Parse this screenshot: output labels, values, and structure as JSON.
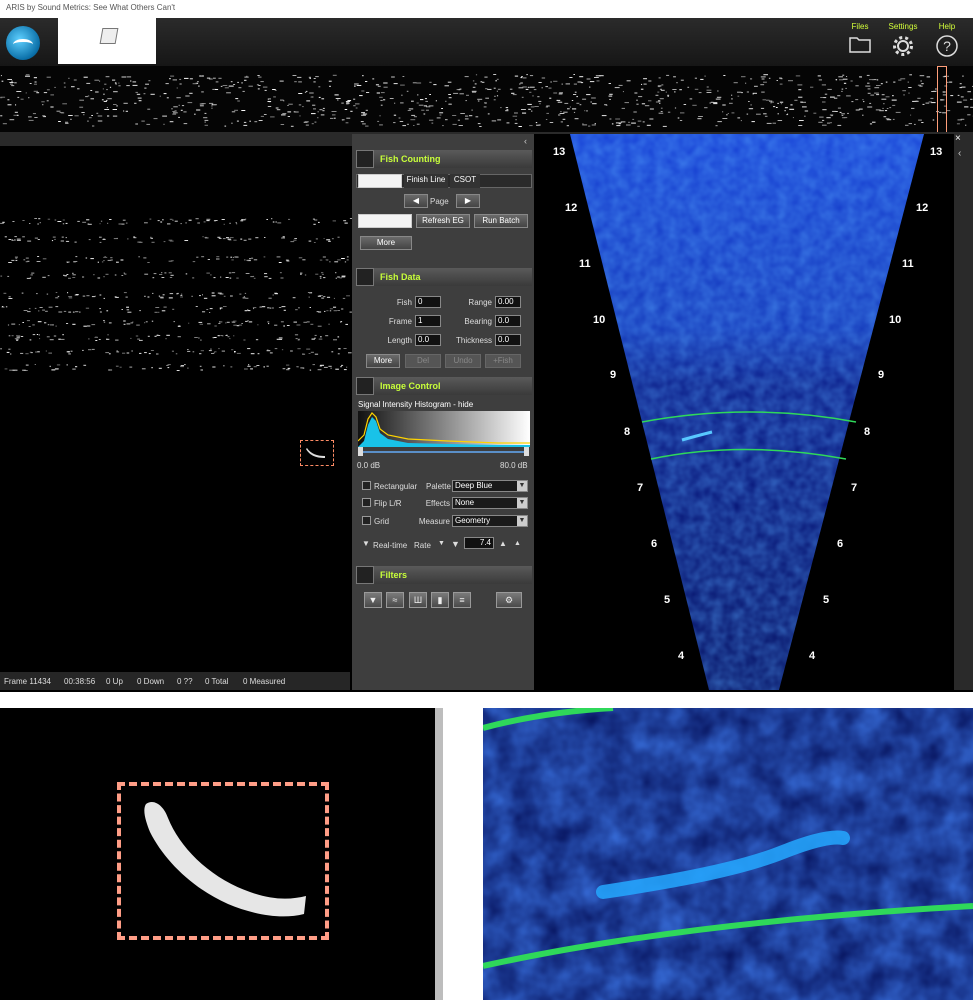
{
  "window": {
    "title": "ARIS by Sound Metrics: See What Others Can't"
  },
  "toolbar": {
    "files_label": "Files",
    "settings_label": "Settings",
    "help_label": "Help",
    "files_icon": "folder-icon",
    "settings_icon": "gear-icon",
    "help_icon": "help-icon"
  },
  "status": {
    "frame": "Frame 11434",
    "time": "00:38:56",
    "up": "0 Up",
    "down": "0 Down",
    "unknown": "0 ??",
    "total": "0 Total",
    "measured": "0 Measured"
  },
  "fish_counting": {
    "title": "Fish Counting",
    "tabs": [
      "Finish Line",
      "CSOT"
    ],
    "page_label": "Page",
    "refresh_eg": "Refresh EG",
    "run_batch": "Run Batch",
    "more": "More"
  },
  "fish_data": {
    "title": "Fish Data",
    "fish_label": "Fish",
    "fish_value": "0",
    "range_label": "Range",
    "range_value": "0.00",
    "frame_label": "Frame",
    "frame_value": "1",
    "bearing_label": "Bearing",
    "bearing_value": "0.0",
    "length_label": "Length",
    "length_value": "0.0",
    "thickness_label": "Thickness",
    "thickness_value": "0.0",
    "more": "More",
    "del": "Del",
    "undo": "Undo",
    "add_fish": "+Fish"
  },
  "image_control": {
    "title": "Image Control",
    "histogram_label": "Signal Intensity Histogram - hide",
    "min_db": "0.0 dB",
    "max_db": "80.0 dB",
    "rectangular": "Rectangular",
    "flip": "Flip L/R",
    "grid": "Grid",
    "palette_label": "Palette",
    "palette_value": "Deep Blue",
    "effects_label": "Effects",
    "effects_value": "None",
    "measure_label": "Measure",
    "measure_value": "Geometry",
    "realtime": "Real-time",
    "rate_label": "Rate",
    "rate_value": "7.4"
  },
  "filters": {
    "title": "Filters"
  },
  "range_labels": [
    "13",
    "12",
    "11",
    "10",
    "9",
    "8",
    "7",
    "6",
    "5",
    "4"
  ],
  "colors": {
    "accent": "#c8ff3a",
    "sonar_blue": "#1f4fd6",
    "finish_line": "#2fd85a",
    "marker": "#ff8c66"
  }
}
